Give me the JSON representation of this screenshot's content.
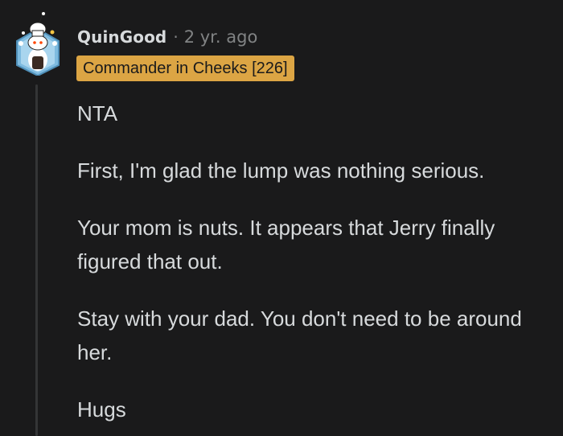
{
  "comment": {
    "author": "QuinGood",
    "separator": "·",
    "time": "2 yr. ago",
    "flair": "Commander in Cheeks [226]",
    "paragraphs": [
      "NTA",
      "First, I'm glad the lump was nothing serious.",
      "Your mom is nuts. It appears that Jerry finally figured that out.",
      "Stay with your dad. You don't need to be around her.",
      "Hugs"
    ]
  },
  "colors": {
    "background": "#1a1a1b",
    "text": "#d7dadc",
    "muted": "#818384",
    "flair_bg": "#dca544",
    "thread_line": "#343536"
  },
  "icons": {
    "avatar": "snoo-chef-avatar-icon"
  }
}
